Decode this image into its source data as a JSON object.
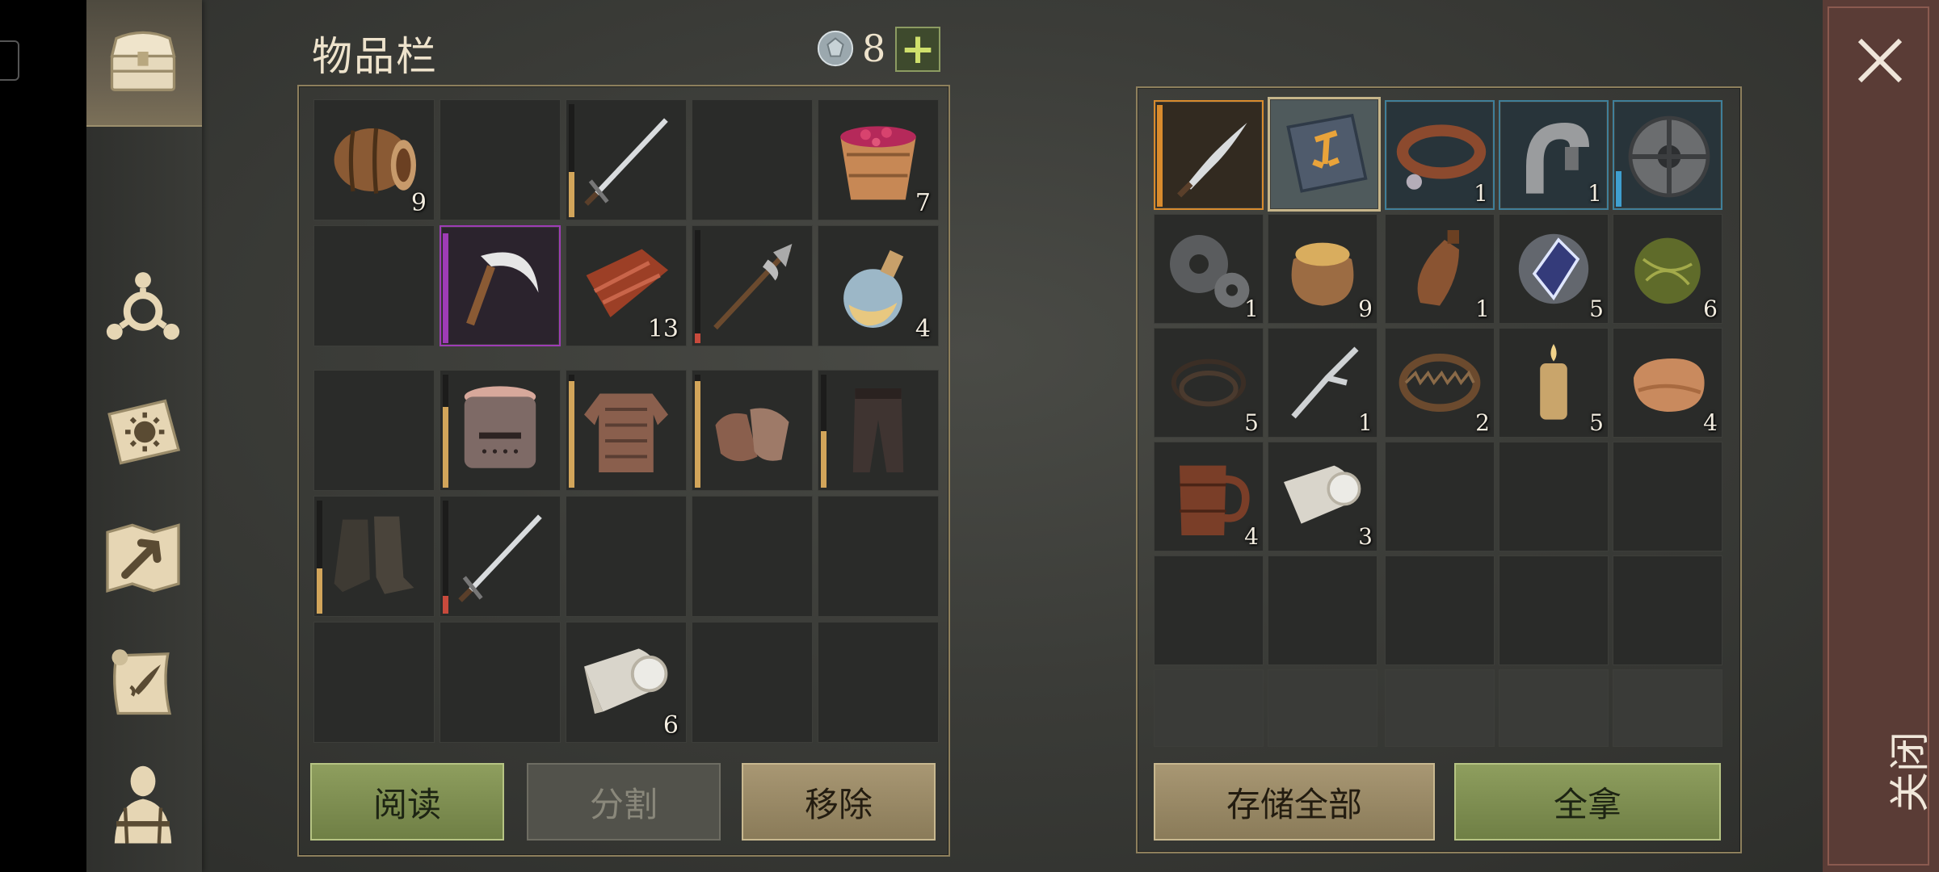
{
  "header": {
    "title": "物品栏",
    "gem_count": "8",
    "plus": "+"
  },
  "inventory": {
    "quantities": {
      "barrel": "9",
      "berry_bucket": "7",
      "meat": "13",
      "potion": "4",
      "cloth": "6"
    }
  },
  "container": {
    "quantities": {
      "collar": "1",
      "clamp": "1",
      "gears": "1",
      "grain_sack": "9",
      "flask": "1",
      "crystal": "5",
      "herbs": "6",
      "rope": "5",
      "fork": "1",
      "trap": "2",
      "candle": "5",
      "leather": "4",
      "mug": "4",
      "bandage": "3"
    }
  },
  "buttons": {
    "read": "阅读",
    "split": "分割",
    "remove": "移除",
    "store_all": "存储全部",
    "take_all": "全拿"
  },
  "close": {
    "label": "关闭"
  },
  "colors": {
    "durability_gold": "#d2a55a",
    "durability_red": "#c84a3c",
    "rarity_purple": "#9e3cb6",
    "rarity_blue": "#3f9fcf",
    "rarity_orange": "#d98b2d"
  },
  "icons": {
    "sidebar": [
      "chest-icon",
      "crafting-icon",
      "journal-icon",
      "map-icon",
      "scroll-icon",
      "character-icon"
    ]
  }
}
